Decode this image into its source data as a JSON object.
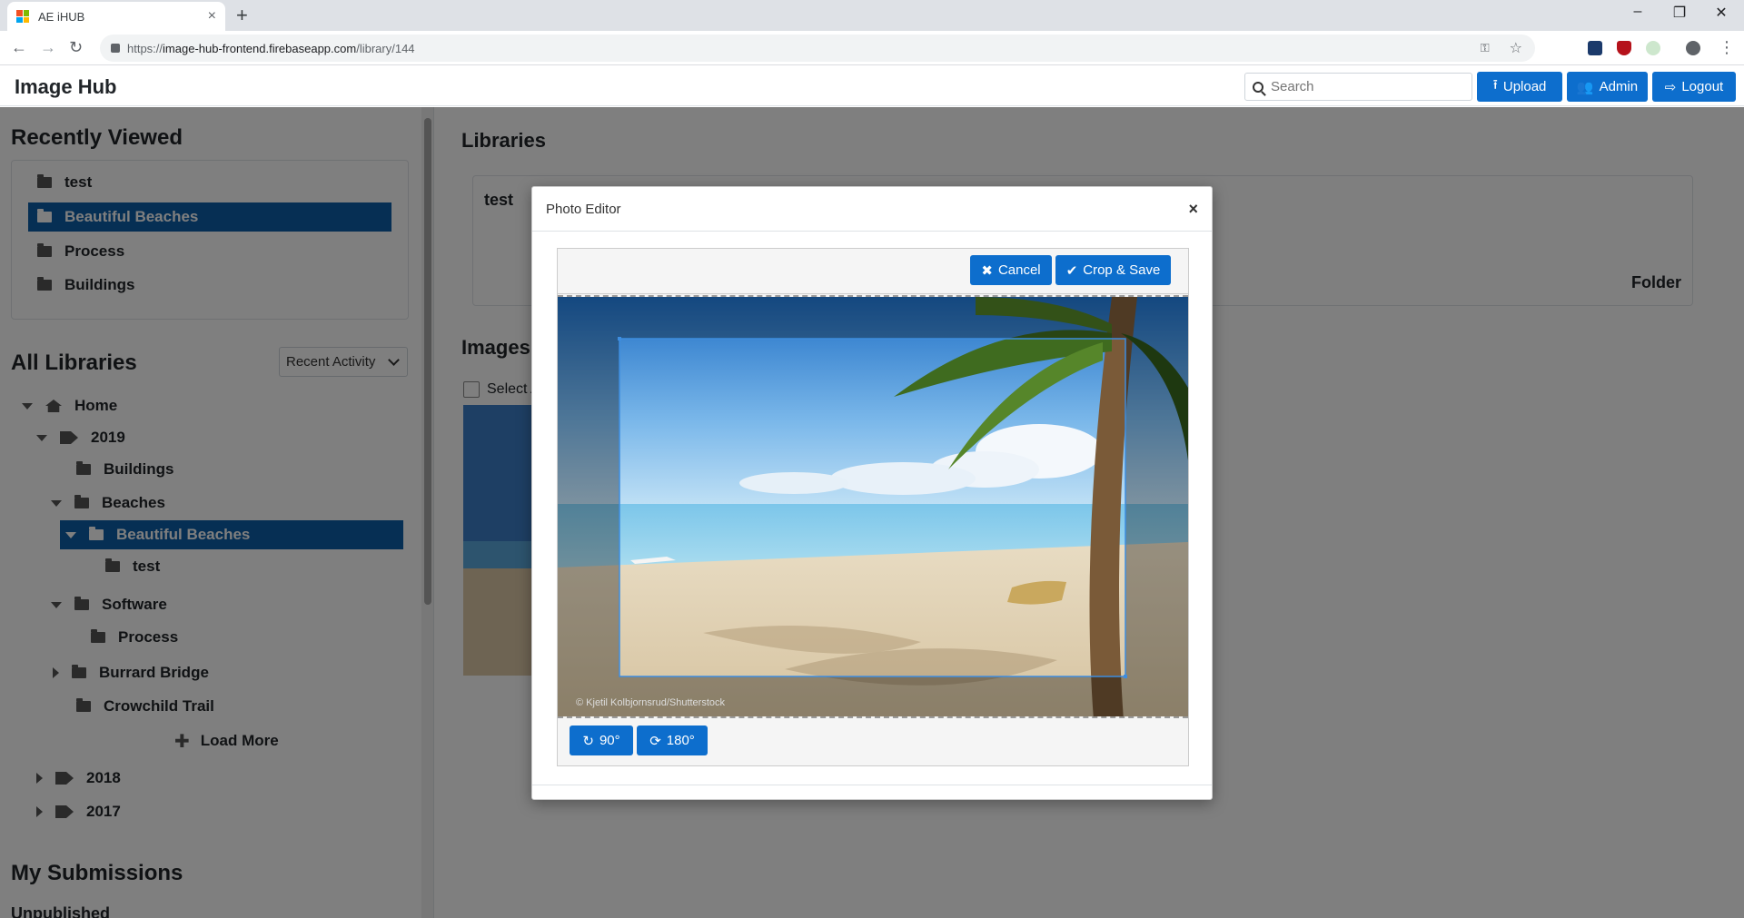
{
  "browser": {
    "tab_title": "AE iHUB",
    "tab_close": "×",
    "new_tab": "+",
    "url_scheme": "https://",
    "url_host": "image-hub-frontend.firebaseapp.com",
    "url_path": "/library/144",
    "win_min": "–",
    "win_max": "❐",
    "win_close": "✕"
  },
  "header": {
    "brand": "Image Hub",
    "search_placeholder": "Search",
    "upload_label": "Upload",
    "admin_label": "Admin",
    "logout_label": "Logout"
  },
  "sidebar": {
    "recently_viewed_title": "Recently Viewed",
    "recent_items": [
      "test",
      "Beautiful Beaches",
      "Process",
      "Buildings"
    ],
    "all_libraries_title": "All Libraries",
    "sort_value": "Recent Activity",
    "tree": {
      "home": "Home",
      "y2019": "2019",
      "buildings": "Buildings",
      "beaches": "Beaches",
      "beautiful_beaches": "Beautiful Beaches",
      "test": "test",
      "software": "Software",
      "process": "Process",
      "burrard_bridge": "Burrard Bridge",
      "crowchild_trail": "Crowchild Trail",
      "load_more": "Load More",
      "y2018": "2018",
      "y2017": "2017"
    },
    "my_submissions_title": "My Submissions",
    "unpublished": "Unpublished"
  },
  "main": {
    "libraries_title": "Libraries",
    "library_card_name": "test",
    "library_card_kind": "Folder",
    "images_title": "Images",
    "select_all": "Select A"
  },
  "modal": {
    "title": "Photo Editor",
    "close": "×",
    "cancel_label": "Cancel",
    "crop_save_label": "Crop & Save",
    "rotate90_label": "90°",
    "rotate180_label": "180°",
    "watermark": "© Kjetil Kolbjornsrud/Shutterstock"
  },
  "colors": {
    "primary": "#0d6ecd",
    "active": "#0d5ea8"
  }
}
